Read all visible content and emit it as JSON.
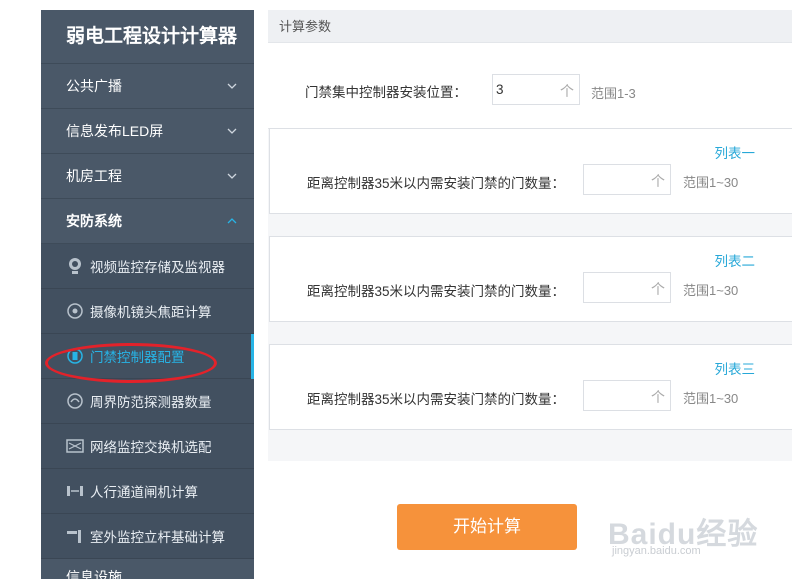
{
  "sidebar": {
    "title": "弱电工程设计计算器",
    "groups": [
      {
        "label": "公共广播"
      },
      {
        "label": "信息发布LED屏"
      },
      {
        "label": "机房工程"
      },
      {
        "label": "安防系统"
      }
    ],
    "sub_items": [
      {
        "label": "视频监控存储及监视器",
        "icon": "camera-icon"
      },
      {
        "label": "摄像机镜头焦距计算",
        "icon": "lens-icon"
      },
      {
        "label": "门禁控制器配置",
        "icon": "door-controller-icon"
      },
      {
        "label": "周界防范探测器数量",
        "icon": "detector-icon"
      },
      {
        "label": "网络监控交换机选配",
        "icon": "switch-icon"
      },
      {
        "label": "人行通道闸机计算",
        "icon": "gate-icon"
      },
      {
        "label": "室外监控立杆基础计算",
        "icon": "pole-icon"
      }
    ],
    "next_group": "信息设施",
    "active_color": "#27b4e6"
  },
  "panel": {
    "header": "计算参数",
    "controller_position_label": "门禁集中控制器安装位置：",
    "controller_position_value": "3",
    "unit": "个",
    "controller_range": "范围1-3",
    "cards": [
      {
        "title": "列表一",
        "label": "距离控制器35米以内需安装门禁的门数量：",
        "value": "",
        "unit": "个",
        "range": "范围1~30"
      },
      {
        "title": "列表二",
        "label": "距离控制器35米以内需安装门禁的门数量：",
        "value": "",
        "unit": "个",
        "range": "范围1~30"
      },
      {
        "title": "列表三",
        "label": "距离控制器35米以内需安装门禁的门数量：",
        "value": "",
        "unit": "个",
        "range": "范围1~30"
      }
    ]
  },
  "start_button": "开始计算",
  "watermark": {
    "text": "Baidu经验",
    "sub": "jingyan.baidu.com"
  },
  "colors": {
    "button": "#f6923b",
    "highlight_circle": "#e3222a",
    "link": "#27a8d8"
  }
}
